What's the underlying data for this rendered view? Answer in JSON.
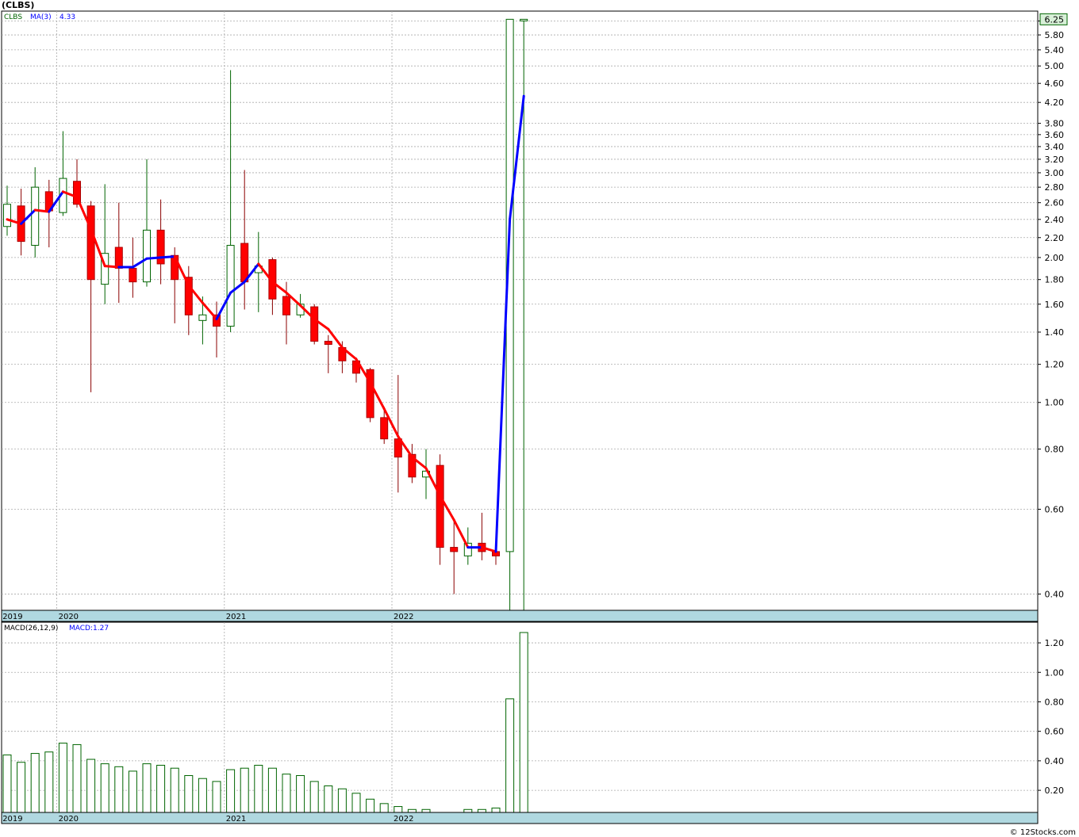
{
  "header": {
    "title": "(CLBS)"
  },
  "footer": {
    "copyright": "© 12Stocks.com"
  },
  "colors": {
    "up": "#006400",
    "down": "#ff0000",
    "ma_up": "#0000ff",
    "ma_down": "#ff0000",
    "axis_band": "#b0d8e0",
    "grid": "#aaaaaa",
    "highlight": "#d8f0d8"
  },
  "chart_data": [
    {
      "type": "candlestick",
      "scale": "log",
      "legend": {
        "symbol": "CLBS",
        "ma_label": "MA(3)",
        "ma_value": "4.33"
      },
      "last_price_label": "6.25",
      "ylim": [
        0.37,
        6.5
      ],
      "yticks": [
        "6.20",
        "5.80",
        "5.40",
        "5.00",
        "4.60",
        "4.20",
        "3.80",
        "3.60",
        "3.40",
        "3.20",
        "3.00",
        "2.80",
        "2.60",
        "2.40",
        "2.20",
        "2.00",
        "1.80",
        "1.60",
        "1.40",
        "1.20",
        "1.00",
        "0.80",
        "0.60",
        "0.40"
      ],
      "x_labels": [
        {
          "label": "2019",
          "index": 0
        },
        {
          "label": "2020",
          "index": 4
        },
        {
          "label": "2021",
          "index": 16
        },
        {
          "label": "2022",
          "index": 28
        }
      ],
      "candles": [
        {
          "o": 2.32,
          "h": 2.82,
          "l": 2.22,
          "c": 2.58
        },
        {
          "o": 2.56,
          "h": 2.78,
          "l": 2.02,
          "c": 2.16
        },
        {
          "o": 2.12,
          "h": 3.08,
          "l": 2.0,
          "c": 2.8
        },
        {
          "o": 2.74,
          "h": 2.9,
          "l": 2.1,
          "c": 2.5
        },
        {
          "o": 2.48,
          "h": 3.66,
          "l": 2.44,
          "c": 2.92
        },
        {
          "o": 2.88,
          "h": 3.2,
          "l": 2.54,
          "c": 2.58
        },
        {
          "o": 2.56,
          "h": 2.62,
          "l": 1.05,
          "c": 1.8
        },
        {
          "o": 1.76,
          "h": 2.84,
          "l": 1.6,
          "c": 2.04
        },
        {
          "o": 2.1,
          "h": 2.6,
          "l": 1.61,
          "c": 1.9
        },
        {
          "o": 1.9,
          "h": 2.2,
          "l": 1.65,
          "c": 1.78
        },
        {
          "o": 1.78,
          "h": 3.2,
          "l": 1.74,
          "c": 2.28
        },
        {
          "o": 2.28,
          "h": 2.64,
          "l": 1.76,
          "c": 1.94
        },
        {
          "o": 2.02,
          "h": 2.1,
          "l": 1.46,
          "c": 1.8
        },
        {
          "o": 1.82,
          "h": 1.92,
          "l": 1.38,
          "c": 1.52
        },
        {
          "o": 1.48,
          "h": 1.66,
          "l": 1.32,
          "c": 1.52
        },
        {
          "o": 1.52,
          "h": 1.62,
          "l": 1.24,
          "c": 1.44
        },
        {
          "o": 1.44,
          "h": 4.9,
          "l": 1.4,
          "c": 2.12
        },
        {
          "o": 2.14,
          "h": 3.04,
          "l": 1.56,
          "c": 1.78
        },
        {
          "o": 1.86,
          "h": 2.26,
          "l": 1.54,
          "c": 1.92
        },
        {
          "o": 1.98,
          "h": 2.0,
          "l": 1.52,
          "c": 1.64
        },
        {
          "o": 1.66,
          "h": 1.78,
          "l": 1.32,
          "c": 1.52
        },
        {
          "o": 1.52,
          "h": 1.68,
          "l": 1.5,
          "c": 1.6
        },
        {
          "o": 1.58,
          "h": 1.6,
          "l": 1.32,
          "c": 1.34
        },
        {
          "o": 1.34,
          "h": 1.38,
          "l": 1.15,
          "c": 1.32
        },
        {
          "o": 1.3,
          "h": 1.34,
          "l": 1.15,
          "c": 1.22
        },
        {
          "o": 1.22,
          "h": 1.24,
          "l": 1.1,
          "c": 1.15
        },
        {
          "o": 1.17,
          "h": 1.18,
          "l": 0.91,
          "c": 0.93
        },
        {
          "o": 0.93,
          "h": 0.98,
          "l": 0.82,
          "c": 0.84
        },
        {
          "o": 0.84,
          "h": 1.14,
          "l": 0.65,
          "c": 0.77
        },
        {
          "o": 0.78,
          "h": 0.82,
          "l": 0.68,
          "c": 0.7
        },
        {
          "o": 0.7,
          "h": 0.8,
          "l": 0.63,
          "c": 0.72
        },
        {
          "o": 0.74,
          "h": 0.78,
          "l": 0.46,
          "c": 0.5
        },
        {
          "o": 0.5,
          "h": 0.57,
          "l": 0.4,
          "c": 0.49
        },
        {
          "o": 0.48,
          "h": 0.55,
          "l": 0.46,
          "c": 0.51
        },
        {
          "o": 0.51,
          "h": 0.59,
          "l": 0.47,
          "c": 0.49
        },
        {
          "o": 0.49,
          "h": 0.51,
          "l": 0.46,
          "c": 0.48
        },
        {
          "o": 0.49,
          "h": 6.25,
          "l": 0.37,
          "c": 6.25
        },
        {
          "o": 6.25,
          "h": 6.25,
          "l": 0.37,
          "c": 6.25
        }
      ],
      "ma": [
        2.4,
        2.35,
        2.51,
        2.49,
        2.74,
        2.67,
        2.29,
        1.92,
        1.91,
        1.91,
        1.99,
        2.0,
        2.01,
        1.75,
        1.61,
        1.49,
        1.69,
        1.78,
        1.94,
        1.78,
        1.69,
        1.59,
        1.49,
        1.42,
        1.3,
        1.23,
        1.1,
        0.97,
        0.85,
        0.77,
        0.73,
        0.64,
        0.57,
        0.5,
        0.5,
        0.49,
        2.4,
        4.33
      ]
    },
    {
      "type": "bar",
      "legend": {
        "name": "MACD(26,12,9)",
        "value_label": "MACD:1.27"
      },
      "ylim": [
        0.05,
        1.34
      ],
      "yticks": [
        "1.20",
        "1.00",
        "0.80",
        "0.60",
        "0.40",
        "0.20"
      ],
      "x_labels": [
        {
          "label": "2019",
          "index": 0
        },
        {
          "label": "2020",
          "index": 4
        },
        {
          "label": "2021",
          "index": 16
        },
        {
          "label": "2022",
          "index": 28
        }
      ],
      "values": [
        0.44,
        0.39,
        0.45,
        0.46,
        0.52,
        0.51,
        0.41,
        0.38,
        0.36,
        0.33,
        0.38,
        0.37,
        0.35,
        0.3,
        0.28,
        0.26,
        0.34,
        0.35,
        0.37,
        0.35,
        0.31,
        0.3,
        0.26,
        0.23,
        0.21,
        0.18,
        0.14,
        0.11,
        0.09,
        0.07,
        0.07,
        0.05,
        0.04,
        0.07,
        0.07,
        0.08,
        0.82,
        1.27
      ]
    }
  ]
}
